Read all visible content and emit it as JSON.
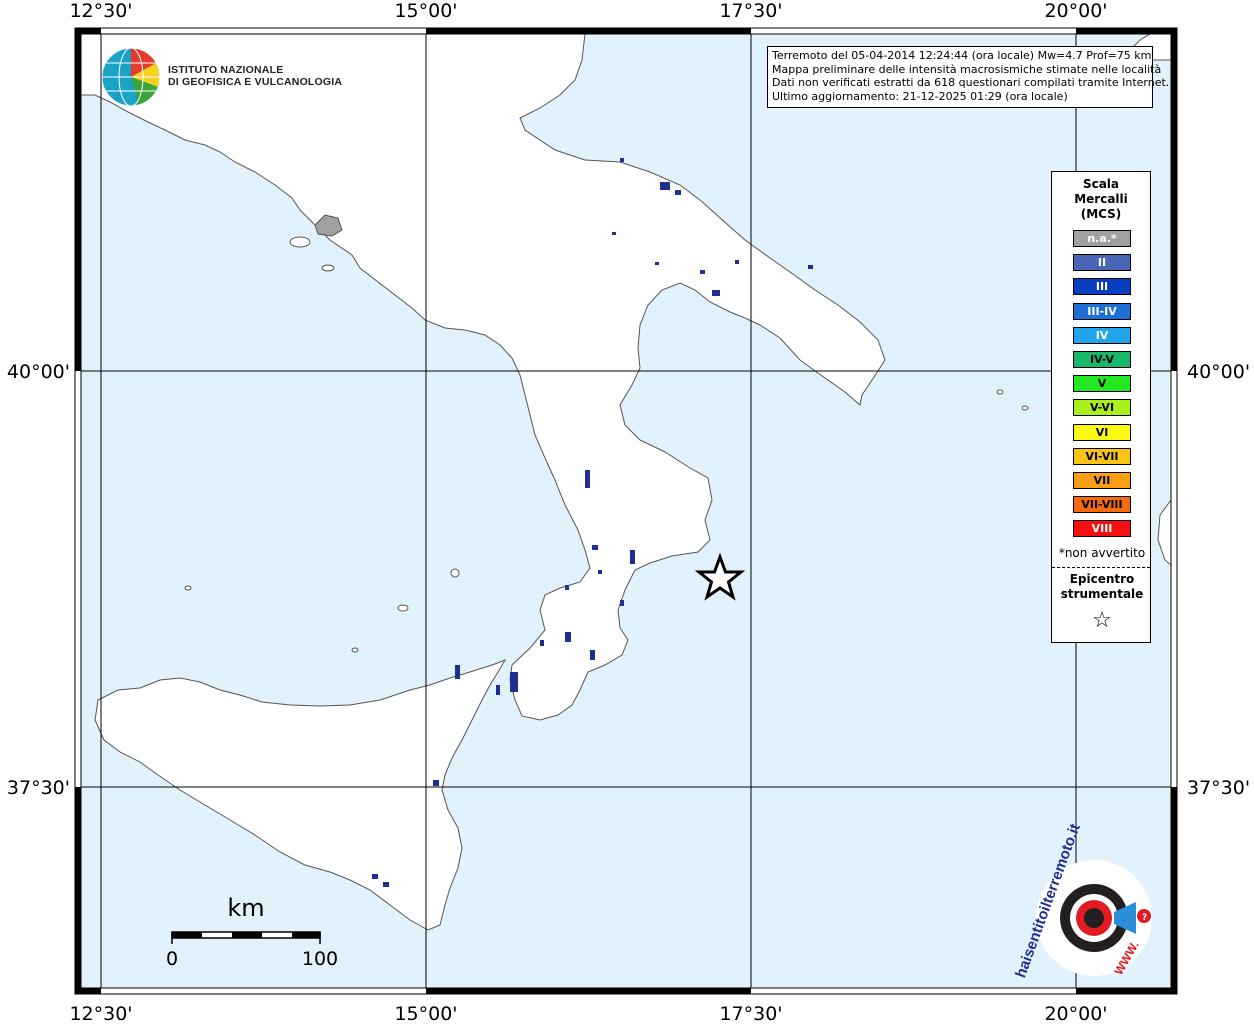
{
  "map": {
    "top_labels": [
      "12°30'",
      "15°00'",
      "17°30'",
      "20°00'"
    ],
    "bottom_labels": [
      "12°30'",
      "15°00'",
      "17°30'",
      "20°00'"
    ],
    "left_labels": [
      "40°00'",
      "37°30'"
    ],
    "right_labels": [
      "40°00'",
      "37°30'"
    ],
    "colors": {
      "sea": "#e1f2fd",
      "land": "#ffffff",
      "coast": "#555555",
      "localities": "#1f2f8f"
    }
  },
  "logo": {
    "line1": "ISTITUTO NAZIONALE",
    "line2": "DI GEOFISICA E VULCANOLOGIA"
  },
  "info": {
    "line1": "Terremoto del 05-04-2014 12:24:44 (ora locale) Mw=4.7 Prof=75 km",
    "line2": "Mappa preliminare delle intensità macrosismiche stimate nelle località",
    "line3": "Dati non verificati estratti da 618 questionari compilati tramite Internet.",
    "line4": "Ultimo aggiornamento: 21-12-2025 01:29 (ora locale)"
  },
  "legend": {
    "title_lines": [
      "Scala",
      "Mercalli",
      "(MCS)"
    ],
    "items": [
      {
        "label": "n.a.*",
        "color": "#a0a0a0",
        "text_color": "#ffffff"
      },
      {
        "label": "II",
        "color": "#4a66b8",
        "text_color": "#ffffff"
      },
      {
        "label": "III",
        "color": "#0a3ec2",
        "text_color": "#ffffff"
      },
      {
        "label": "III-IV",
        "color": "#1f6fd6",
        "text_color": "#ffffff"
      },
      {
        "label": "IV",
        "color": "#20a4ec",
        "text_color": "#ffffff"
      },
      {
        "label": "IV-V",
        "color": "#18b86a",
        "text_color": "#000000"
      },
      {
        "label": "V",
        "color": "#21e821",
        "text_color": "#000000"
      },
      {
        "label": "V-VI",
        "color": "#a8f01c",
        "text_color": "#000000"
      },
      {
        "label": "VI",
        "color": "#fbf914",
        "text_color": "#000000"
      },
      {
        "label": "VI-VII",
        "color": "#fbc414",
        "text_color": "#000000"
      },
      {
        "label": "VII",
        "color": "#fb9e14",
        "text_color": "#000000"
      },
      {
        "label": "VII-VIII",
        "color": "#f86a10",
        "text_color": "#000000"
      },
      {
        "label": "VIII",
        "color": "#f81010",
        "text_color": "#ffffff"
      }
    ],
    "note": "*non avvertito",
    "epicenter_lines": [
      "Epicentro",
      "strumentale"
    ],
    "star": "☆"
  },
  "scalebar": {
    "unit": "km",
    "start": "0",
    "end": "100"
  },
  "brand": {
    "text": "haisentitoilterremoto.it",
    "www": "WWW."
  }
}
